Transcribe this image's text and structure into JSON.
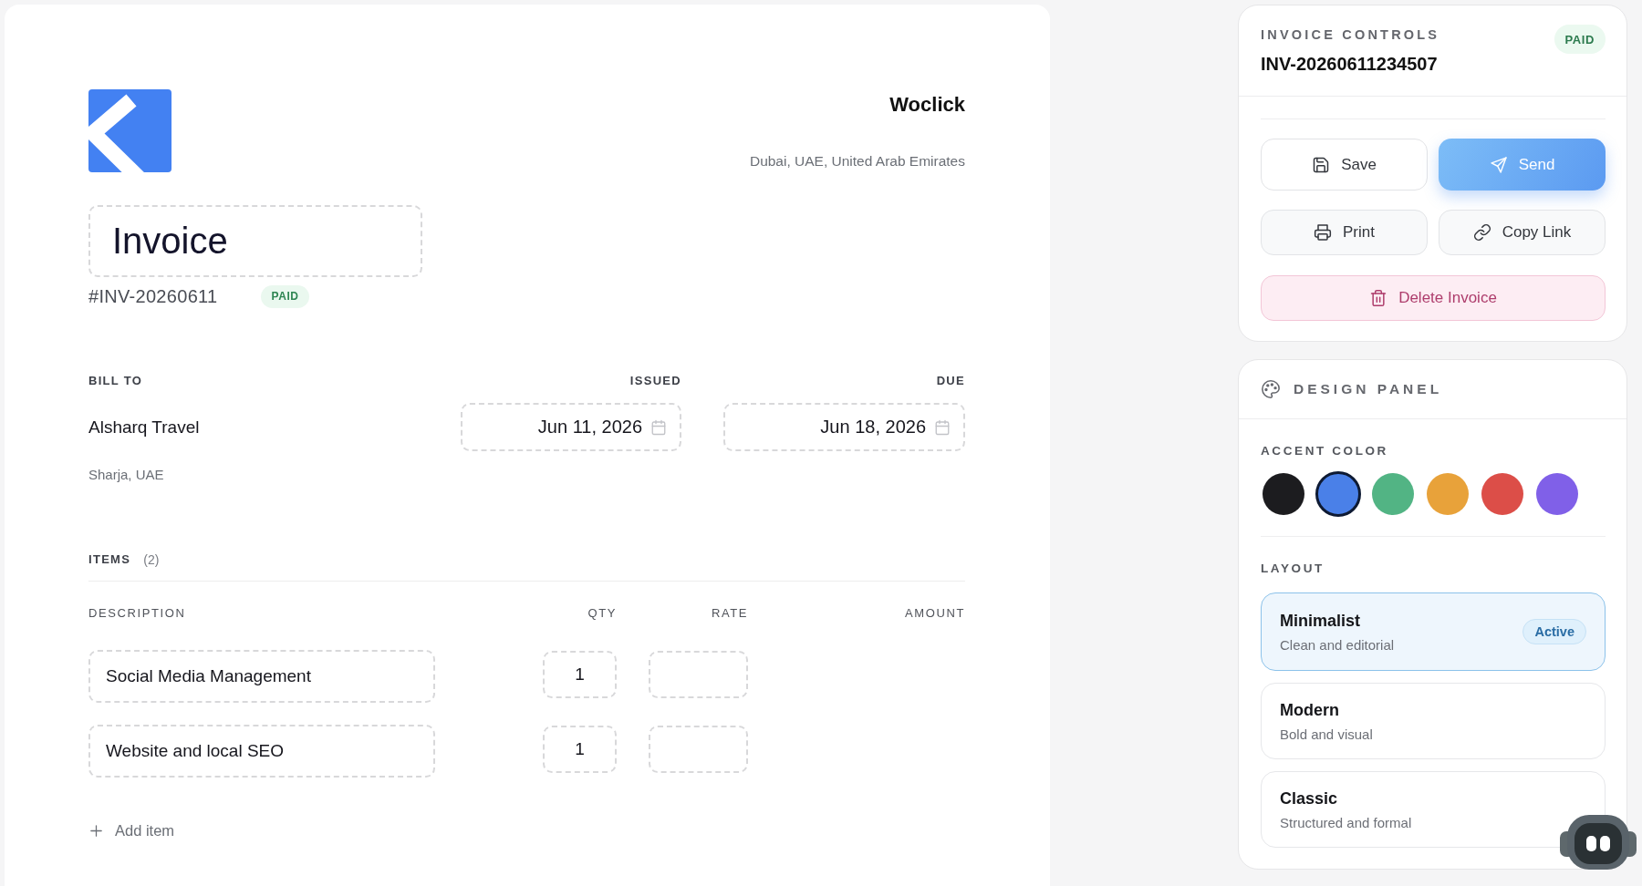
{
  "invoice": {
    "company": {
      "name": "Woclick",
      "address": "Dubai, UAE, United Arab Emirates"
    },
    "title": "Invoice",
    "number": "#INV-20260611",
    "status": "PAID",
    "bill_to": {
      "label": "BILL TO",
      "name": "Alsharq Travel",
      "address": "Sharja, UAE"
    },
    "dates": [
      {
        "label": "ISSUED",
        "value": "Jun 11, 2026"
      },
      {
        "label": "DUE",
        "value": "Jun 18, 2026"
      }
    ],
    "items": {
      "label": "ITEMS",
      "count": "(2)",
      "columns": [
        "DESCRIPTION",
        "QTY",
        "RATE",
        "AMOUNT"
      ],
      "rows": [
        {
          "description": "Social Media Management",
          "qty": "1"
        },
        {
          "description": "Website and local SEO",
          "qty": "1"
        }
      ],
      "add_label": "Add item"
    }
  },
  "invoice_controls": {
    "title": "INVOICE CONTROLS",
    "invoice_id": "INV-20260611234507",
    "status": "PAID",
    "buttons": [
      {
        "kind": "save",
        "label": "Save"
      },
      {
        "kind": "send",
        "label": "Send"
      },
      {
        "kind": "print",
        "label": "Print"
      },
      {
        "kind": "link",
        "label": "Copy Link"
      },
      {
        "kind": "delete",
        "label": "Delete Invoice"
      }
    ]
  },
  "design_panel": {
    "title": "DESIGN PANEL",
    "accent_label": "ACCENT COLOR",
    "accent_colors": [
      {
        "color": "#1c1c1f",
        "selected": false
      },
      {
        "color": "#4a80e8",
        "selected": true
      },
      {
        "color": "#52b484",
        "selected": false
      },
      {
        "color": "#e8a23a",
        "selected": false
      },
      {
        "color": "#dc4e48",
        "selected": false
      },
      {
        "color": "#8060e8",
        "selected": false
      }
    ],
    "layout_label": "LAYOUT",
    "layouts": [
      {
        "name": "Minimalist",
        "description": "Clean and editorial",
        "selected": true,
        "badge": "Active"
      },
      {
        "name": "Modern",
        "description": "Bold and visual",
        "selected": false
      },
      {
        "name": "Classic",
        "description": "Structured and formal",
        "selected": false
      }
    ]
  }
}
